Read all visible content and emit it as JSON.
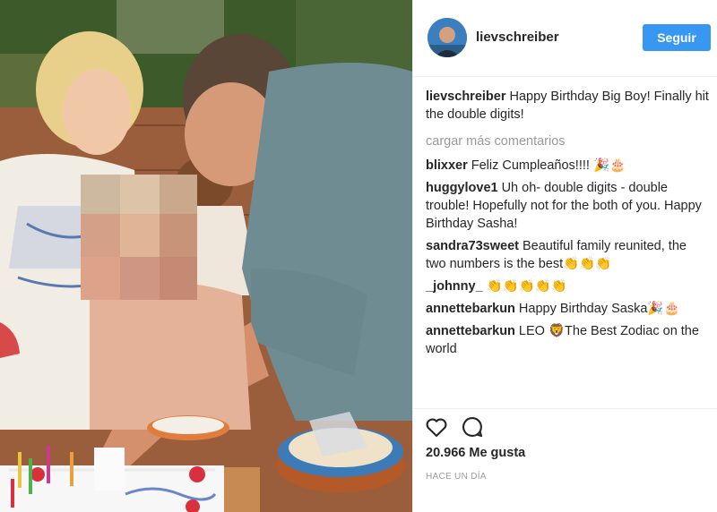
{
  "post": {
    "username": "lievschreiber",
    "follow_label": "Seguir",
    "caption": "Happy Birthday Big Boy! Finally hit the double digits!",
    "load_more": "cargar más comentarios",
    "comments": [
      {
        "user": "blixxer",
        "text": "Feliz Cumpleaños!!!! 🎉🎂"
      },
      {
        "user": "huggylove1",
        "text": "Uh oh- double digits - double trouble! Hopefully not for the both of you. Happy Birthday Sasha!"
      },
      {
        "user": "sandra73sweet",
        "text": "Beautiful family reunited, the two numbers is the best👏👏👏"
      },
      {
        "user": "_johnny_",
        "text": "👏👏👏👏👏"
      },
      {
        "user": "annettebarkun",
        "text": "Happy Birthday Saska🎉🎂"
      },
      {
        "user": "annettebarkun",
        "text": "LEO 🦁The Best Zodiac on the world"
      }
    ],
    "likes": "20.966 Me gusta",
    "timestamp": "HACE UN DÍA"
  },
  "colors": {
    "accent": "#3897f0",
    "text": "#262626",
    "muted": "#999999",
    "border": "#efefef"
  },
  "icons": {
    "like": "heart-outline-icon",
    "comment": "speech-bubble-icon"
  }
}
